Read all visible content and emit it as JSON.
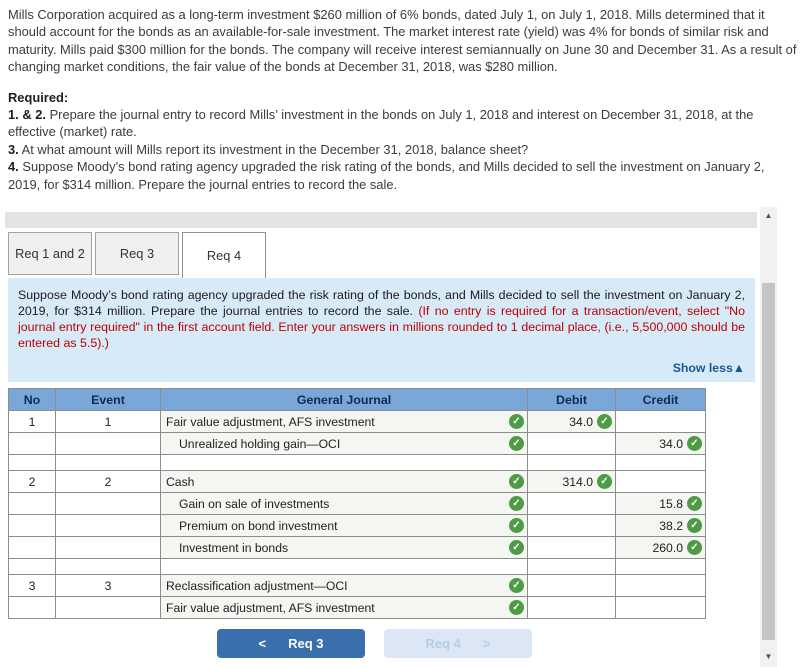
{
  "problem": {
    "intro": "Mills Corporation acquired as a long-term investment $260 million of 6% bonds, dated July 1, on July 1, 2018. Mills determined that it should account for the bonds as an available-for-sale investment. The market interest rate (yield) was 4% for bonds of similar risk and maturity. Mills paid $300 million for the bonds. The company will receive interest semiannually on June 30 and December 31. As a result of changing market conditions, the fair value of the bonds at December 31, 2018, was $280 million.",
    "required_label": "Required:",
    "requirements": [
      {
        "prefix": "1. & 2.",
        "text": " Prepare the journal entry to record Mills’ investment in the bonds on July 1, 2018 and interest on December 31, 2018, at the effective (market) rate."
      },
      {
        "prefix": "3.",
        "text": " At what amount will Mills report its investment in the December 31, 2018, balance sheet?"
      },
      {
        "prefix": "4.",
        "text": " Suppose Moody’s bond rating agency upgraded the risk rating of the bonds, and Mills decided to sell the investment on January 2, 2019, for $314 million. Prepare the journal entries to record the sale."
      }
    ]
  },
  "tabs": [
    {
      "label": "Req 1 and 2"
    },
    {
      "label": "Req 3"
    },
    {
      "label": "Req 4"
    }
  ],
  "instruction": {
    "main": "Suppose Moody’s bond rating agency upgraded the risk rating of the bonds, and Mills decided to sell the investment on January 2, 2019, for $314 million. Prepare the journal entries to record the sale. ",
    "warning": "(If no entry is required for a transaction/event, select \"No journal entry required\" in the first account field. Enter your answers in millions rounded to 1 decimal place, (i.e., 5,500,000 should be entered as 5.5).)",
    "show_less": "Show less▲"
  },
  "journal_table": {
    "headers": [
      "No",
      "Event",
      "General Journal",
      "Debit",
      "Credit"
    ],
    "rows": [
      {
        "no": "1",
        "event": "1",
        "account": "Fair value adjustment, AFS investment",
        "debit": "34.0",
        "credit": ""
      },
      {
        "no": "",
        "event": "",
        "account": "Unrealized holding gain—OCI",
        "debit": "",
        "credit": "34.0"
      },
      {
        "spacer": true
      },
      {
        "no": "2",
        "event": "2",
        "account": "Cash",
        "debit": "314.0",
        "credit": ""
      },
      {
        "no": "",
        "event": "",
        "account": "Gain on sale of investments",
        "debit": "",
        "credit": "15.8"
      },
      {
        "no": "",
        "event": "",
        "account": "Premium on bond investment",
        "debit": "",
        "credit": "38.2"
      },
      {
        "no": "",
        "event": "",
        "account": "Investment in bonds",
        "debit": "",
        "credit": "260.0"
      },
      {
        "spacer": true
      },
      {
        "no": "3",
        "event": "3",
        "account": "Reclassification adjustment—OCI",
        "debit": "",
        "credit": ""
      },
      {
        "no": "",
        "event": "",
        "account": "Fair value adjustment, AFS investment",
        "debit": "",
        "credit": ""
      }
    ]
  },
  "nav": {
    "prev_chevron": "<",
    "prev_label": "Req 3",
    "next_label": "Req 4",
    "next_chevron": ">"
  },
  "icons": {
    "check": "✓",
    "scroll_up": "▲",
    "scroll_down": "▼"
  },
  "colors": {
    "header_blue": "#79a7da",
    "check_green": "#4e9b45",
    "instruction_bg": "#d7eaf8",
    "warning_red": "#c00000",
    "show_less_blue": "#1a5796",
    "button_blue": "#3a6fae",
    "button_disabled_bg": "#dbe7f5",
    "tab_inactive_bg": "#f0f0f0"
  }
}
